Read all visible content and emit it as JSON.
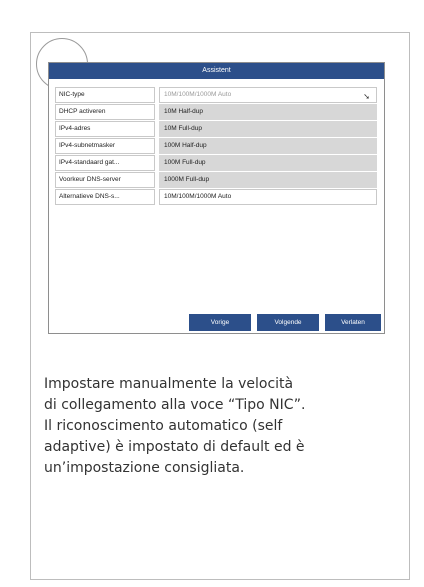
{
  "dialog": {
    "title": "Assistent",
    "rows": [
      {
        "label": "NIC-type",
        "value": "10M/100M/1000M Auto"
      },
      {
        "label": "DHCP activeren",
        "value": "10M Half-dup"
      },
      {
        "label": "IPv4-adres",
        "value": "10M Full-dup"
      },
      {
        "label": "IPv4-subnetmasker",
        "value": "100M Half-dup"
      },
      {
        "label": "IPv4-standaard gat...",
        "value": "100M Full-dup"
      },
      {
        "label": "Voorkeur DNS-server",
        "value": "1000M Full-dup"
      },
      {
        "label": "Alternatieve DNS-s...",
        "value": "10M/100M/1000M Auto"
      }
    ],
    "buttons": {
      "prev": "Vorige",
      "next": "Volgende",
      "exit": "Verlaten"
    }
  },
  "caption": {
    "lines": [
      "Impostare manualmente la velocità",
      "di collegamento alla voce “Tipo NIC”.",
      "Il riconoscimento automatico (self",
      "adaptive) è impostato di default ed è",
      "un’impostazione consigliata."
    ]
  },
  "colors": {
    "accent": "#2c4f8a",
    "option_bg": "#d7d7d7"
  }
}
